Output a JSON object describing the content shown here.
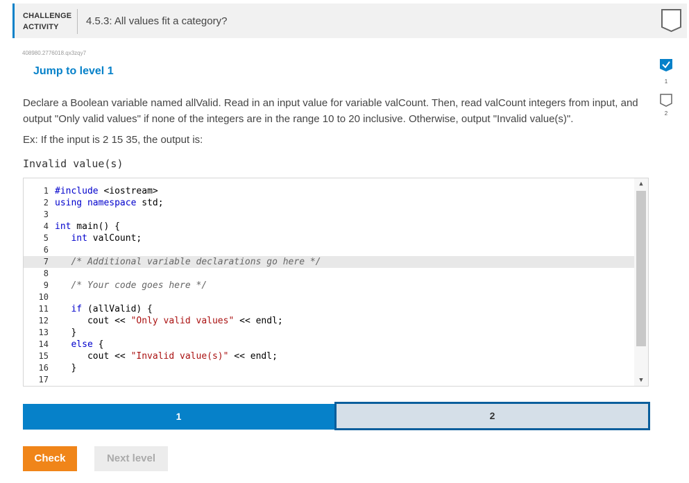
{
  "header": {
    "label_line1": "CHALLENGE",
    "label_line2": "ACTIVITY",
    "title": "4.5.3: All values fit a category?"
  },
  "activity": {
    "id": "408980.2776018.qx3zqy7",
    "jump_label": "Jump to level 1"
  },
  "prompt": {
    "text": "Declare a Boolean variable named allValid. Read in an input value for variable valCount. Then, read valCount integers from input, and output \"Only valid values\" if none of the integers are in the range 10 to 20 inclusive. Otherwise, output \"Invalid value(s)\".",
    "example": "Ex: If the input is 2 15 35, the output is:",
    "example_output": "Invalid value(s)"
  },
  "editor": {
    "line_numbers": [
      "1",
      "2",
      "3",
      "4",
      "5",
      "6",
      "7",
      "8",
      "9",
      "10",
      "11",
      "12",
      "13",
      "14",
      "15",
      "16",
      "17"
    ],
    "lines": [
      "#include <iostream>",
      "using namespace std;",
      "",
      "int main() {",
      "   int valCount;",
      "",
      "   /* Additional variable declarations go here */",
      "",
      "   /* Your code goes here */",
      "",
      "   if (allValid) {",
      "      cout << \"Only valid values\" << endl;",
      "   }",
      "   else {",
      "      cout << \"Invalid value(s)\" << endl;",
      "   }",
      ""
    ],
    "active_line": 7
  },
  "levels": {
    "bar1": "1",
    "bar2": "2",
    "side": [
      "1",
      "2"
    ]
  },
  "buttons": {
    "check": "Check",
    "next": "Next level"
  },
  "colors": {
    "accent": "#0681c9",
    "check_button": "#f08519",
    "level2_border": "#0a5e9c"
  }
}
